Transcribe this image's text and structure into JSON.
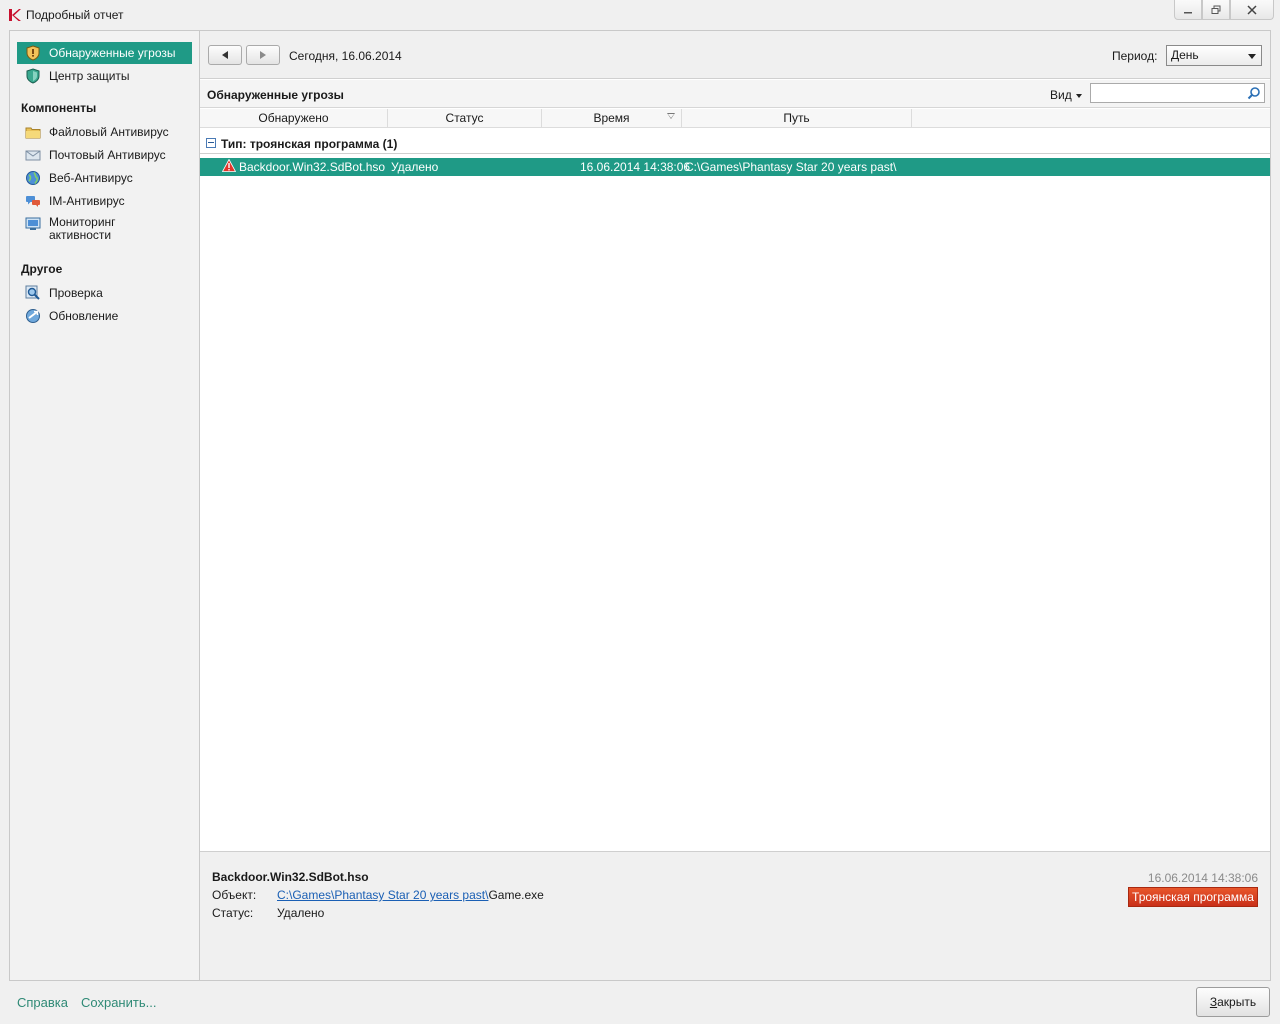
{
  "window": {
    "title": "Подробный отчет"
  },
  "sidebar": {
    "items": [
      {
        "label": "Обнаруженные угрозы"
      },
      {
        "label": "Центр защиты"
      }
    ],
    "components_header": "Компоненты",
    "components": [
      {
        "label": "Файловый Антивирус"
      },
      {
        "label": "Почтовый Антивирус"
      },
      {
        "label": "Веб-Антивирус"
      },
      {
        "label": "IM-Антивирус"
      },
      {
        "label": "Мониторинг активности"
      }
    ],
    "other_header": "Другое",
    "other": [
      {
        "label": "Проверка"
      },
      {
        "label": "Обновление"
      }
    ]
  },
  "toolbar": {
    "date": "Сегодня, 16.06.2014",
    "period_label": "Период:",
    "period_value": "День"
  },
  "list": {
    "title": "Обнаруженные угрозы",
    "view_label": "Вид",
    "search_value": "",
    "columns": [
      "Обнаружено",
      "Статус",
      "Время",
      "Путь"
    ],
    "group_label": "Тип: троянская программа (1)",
    "rows": [
      {
        "detected": "Backdoor.Win32.SdBot.hso",
        "status": "Удалено",
        "time": "16.06.2014 14:38:06",
        "path": "C:\\Games\\Phantasy Star 20 years past\\"
      }
    ]
  },
  "details": {
    "name": "Backdoor.Win32.SdBot.hso",
    "object_label": "Объект:",
    "object_path": "C:\\Games\\Phantasy Star 20 years past\\",
    "object_file": "Game.exe",
    "status_label": "Статус:",
    "status_value": "Удалено",
    "time": "16.06.2014 14:38:06",
    "badge": "Троянская программа"
  },
  "footer": {
    "help": "Справка",
    "save": "Сохранить...",
    "close_accel": "З",
    "close_rest": "акрыть"
  },
  "colors": {
    "accent": "#1f9a86",
    "badge": "#d63c1e",
    "link": "#1a5fb4"
  }
}
